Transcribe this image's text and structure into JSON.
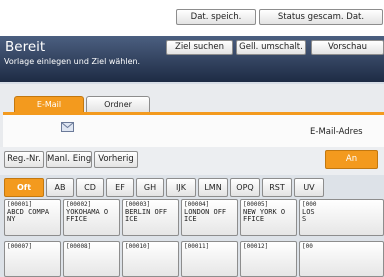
{
  "top_buttons": {
    "dat_speich": "Dat. speich.",
    "status_gescam": "Status gescam. Dat."
  },
  "status": {
    "title": "Bereit",
    "message": "Vorlage einlegen und Ziel wählen.",
    "ziel_suchen": "Ziel suchen",
    "gell_umschalt": "Gell. umschalt.",
    "vorschau": "Vorschau"
  },
  "tabs": [
    {
      "label": "E-Mail",
      "active": true
    },
    {
      "label": "Ordner",
      "active": false
    }
  ],
  "destination": {
    "email_label": "E-Mail-Adres",
    "icon": "mail-icon"
  },
  "action_row": {
    "reg_nr": "Reg.-Nr.",
    "manl_eing": "Manl. Eing.",
    "vorherig": "Vorherig",
    "an": "An"
  },
  "index_keys": [
    "Oft",
    "AB",
    "CD",
    "EF",
    "GH",
    "IJK",
    "LMN",
    "OPQ",
    "RST",
    "UV"
  ],
  "entries": [
    {
      "num": "[00001]",
      "lines": [
        "ABCD COMPA",
        "NY"
      ]
    },
    {
      "num": "[00002]",
      "lines": [
        "YOKOHAMA O",
        "FFICE"
      ]
    },
    {
      "num": "[00003]",
      "lines": [
        "BERLIN OFF",
        "ICE"
      ]
    },
    {
      "num": "[00004]",
      "lines": [
        "LONDON OFF",
        "ICE"
      ]
    },
    {
      "num": "[00005]",
      "lines": [
        "NEW YORK O",
        "FFICE"
      ]
    },
    {
      "num": "[000",
      "lines": [
        "LOS",
        "S"
      ]
    }
  ],
  "entries_row2": [
    "[00007]",
    "[00008]",
    "[00010]",
    "[00011]",
    "[00012]",
    "[00"
  ],
  "colors": {
    "accent": "#f39a1e",
    "status_bg": "#2b3a58"
  }
}
